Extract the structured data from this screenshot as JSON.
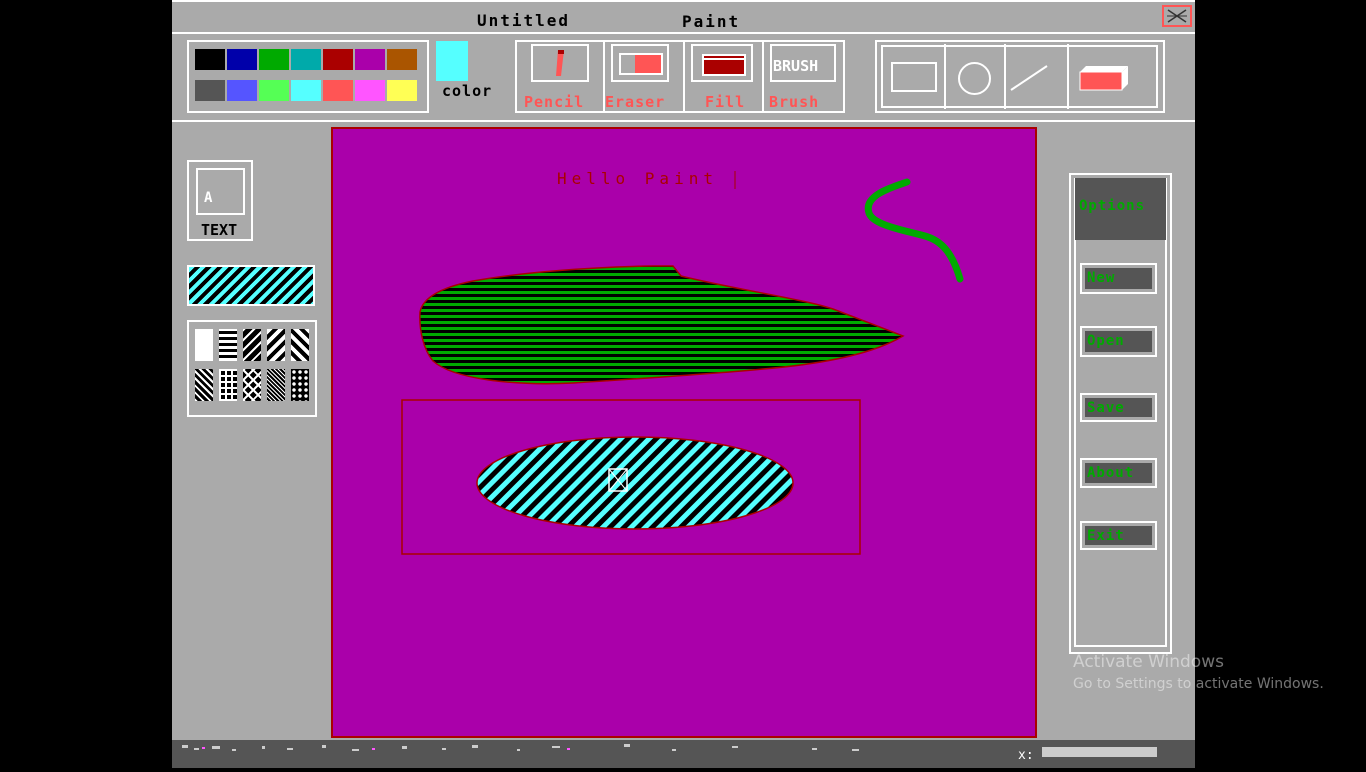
{
  "window": {
    "file_name": "Untitled",
    "app_name": "Paint"
  },
  "palette": {
    "row1": [
      "#000000",
      "#0000aa",
      "#00aa00",
      "#00aaaa",
      "#aa0000",
      "#aa00aa",
      "#aa5500"
    ],
    "row2": [
      "#555555",
      "#5555ff",
      "#55ff55",
      "#55ffff",
      "#ff5555",
      "#ff55ff",
      "#ffff55"
    ],
    "current_color": "#55ffff",
    "color_label": "color"
  },
  "tools": {
    "pencil_label": "Pencil",
    "eraser_label": "Eraser",
    "fill_label": "Fill",
    "brush_label": "Brush",
    "brush_icon_text": "BRUSH"
  },
  "text_tool": {
    "icon_letter": "A",
    "label": "TEXT"
  },
  "canvas": {
    "background": "#aa00aa",
    "text": "Hello Paint"
  },
  "options": {
    "header": "Options",
    "new_label": "New",
    "open_label": "Open",
    "save_label": "Save",
    "about_label": "About",
    "exit_label": "Exit"
  },
  "watermark": {
    "line1": "Activate Windows",
    "line2": "Go to Settings to activate Windows."
  }
}
